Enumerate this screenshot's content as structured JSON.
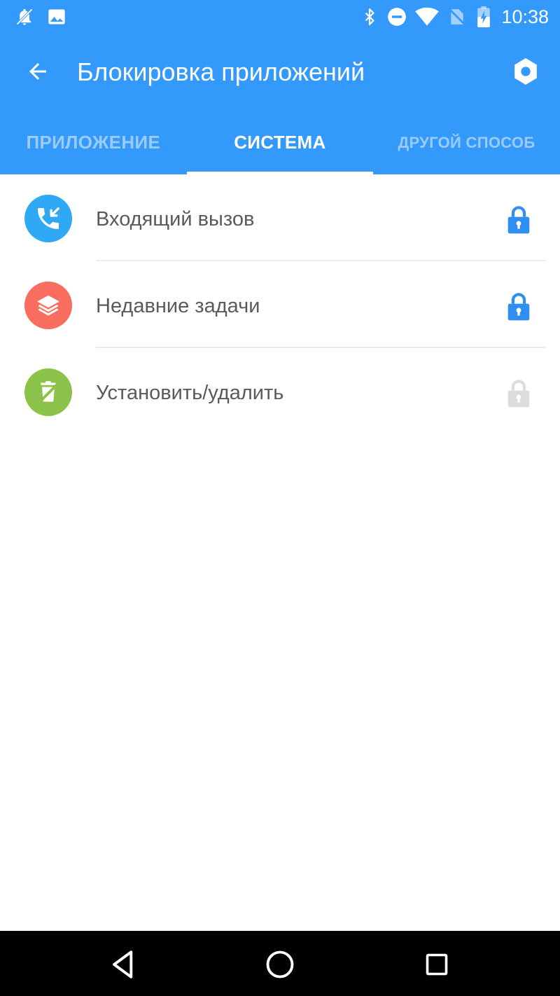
{
  "status_bar": {
    "time": "10:38",
    "left_icons": [
      "notifications-off-icon",
      "image-icon"
    ],
    "right_icons": [
      "bluetooth-icon",
      "do-not-disturb-icon",
      "wifi-icon",
      "no-sim-icon",
      "battery-charging-icon"
    ]
  },
  "toolbar": {
    "title": "Блокировка приложений",
    "back_icon": "arrow-back-icon",
    "settings_icon": "settings-hexagon-icon"
  },
  "tabs": [
    {
      "label": "ПРИЛОЖЕНИЕ",
      "active": false
    },
    {
      "label": "СИСТЕМА",
      "active": true
    },
    {
      "label": "ДРУГОЙ СПОСОБ",
      "active": false
    }
  ],
  "items": [
    {
      "label": "Входящий вызов",
      "icon": "incoming-call-icon",
      "icon_color": "#2fa9f3",
      "locked": true
    },
    {
      "label": "Недавние задачи",
      "icon": "layers-icon",
      "icon_color": "#f96e5e",
      "locked": true
    },
    {
      "label": "Установить/удалить",
      "icon": "install-uninstall-icon",
      "icon_color": "#8bc34a",
      "locked": false
    }
  ],
  "colors": {
    "primary": "#3399fa",
    "lock_active": "#2f8ff0",
    "lock_inactive": "#dcdcdc"
  },
  "navbar": {
    "icons": [
      "nav-back-icon",
      "nav-home-icon",
      "nav-recents-icon"
    ]
  }
}
